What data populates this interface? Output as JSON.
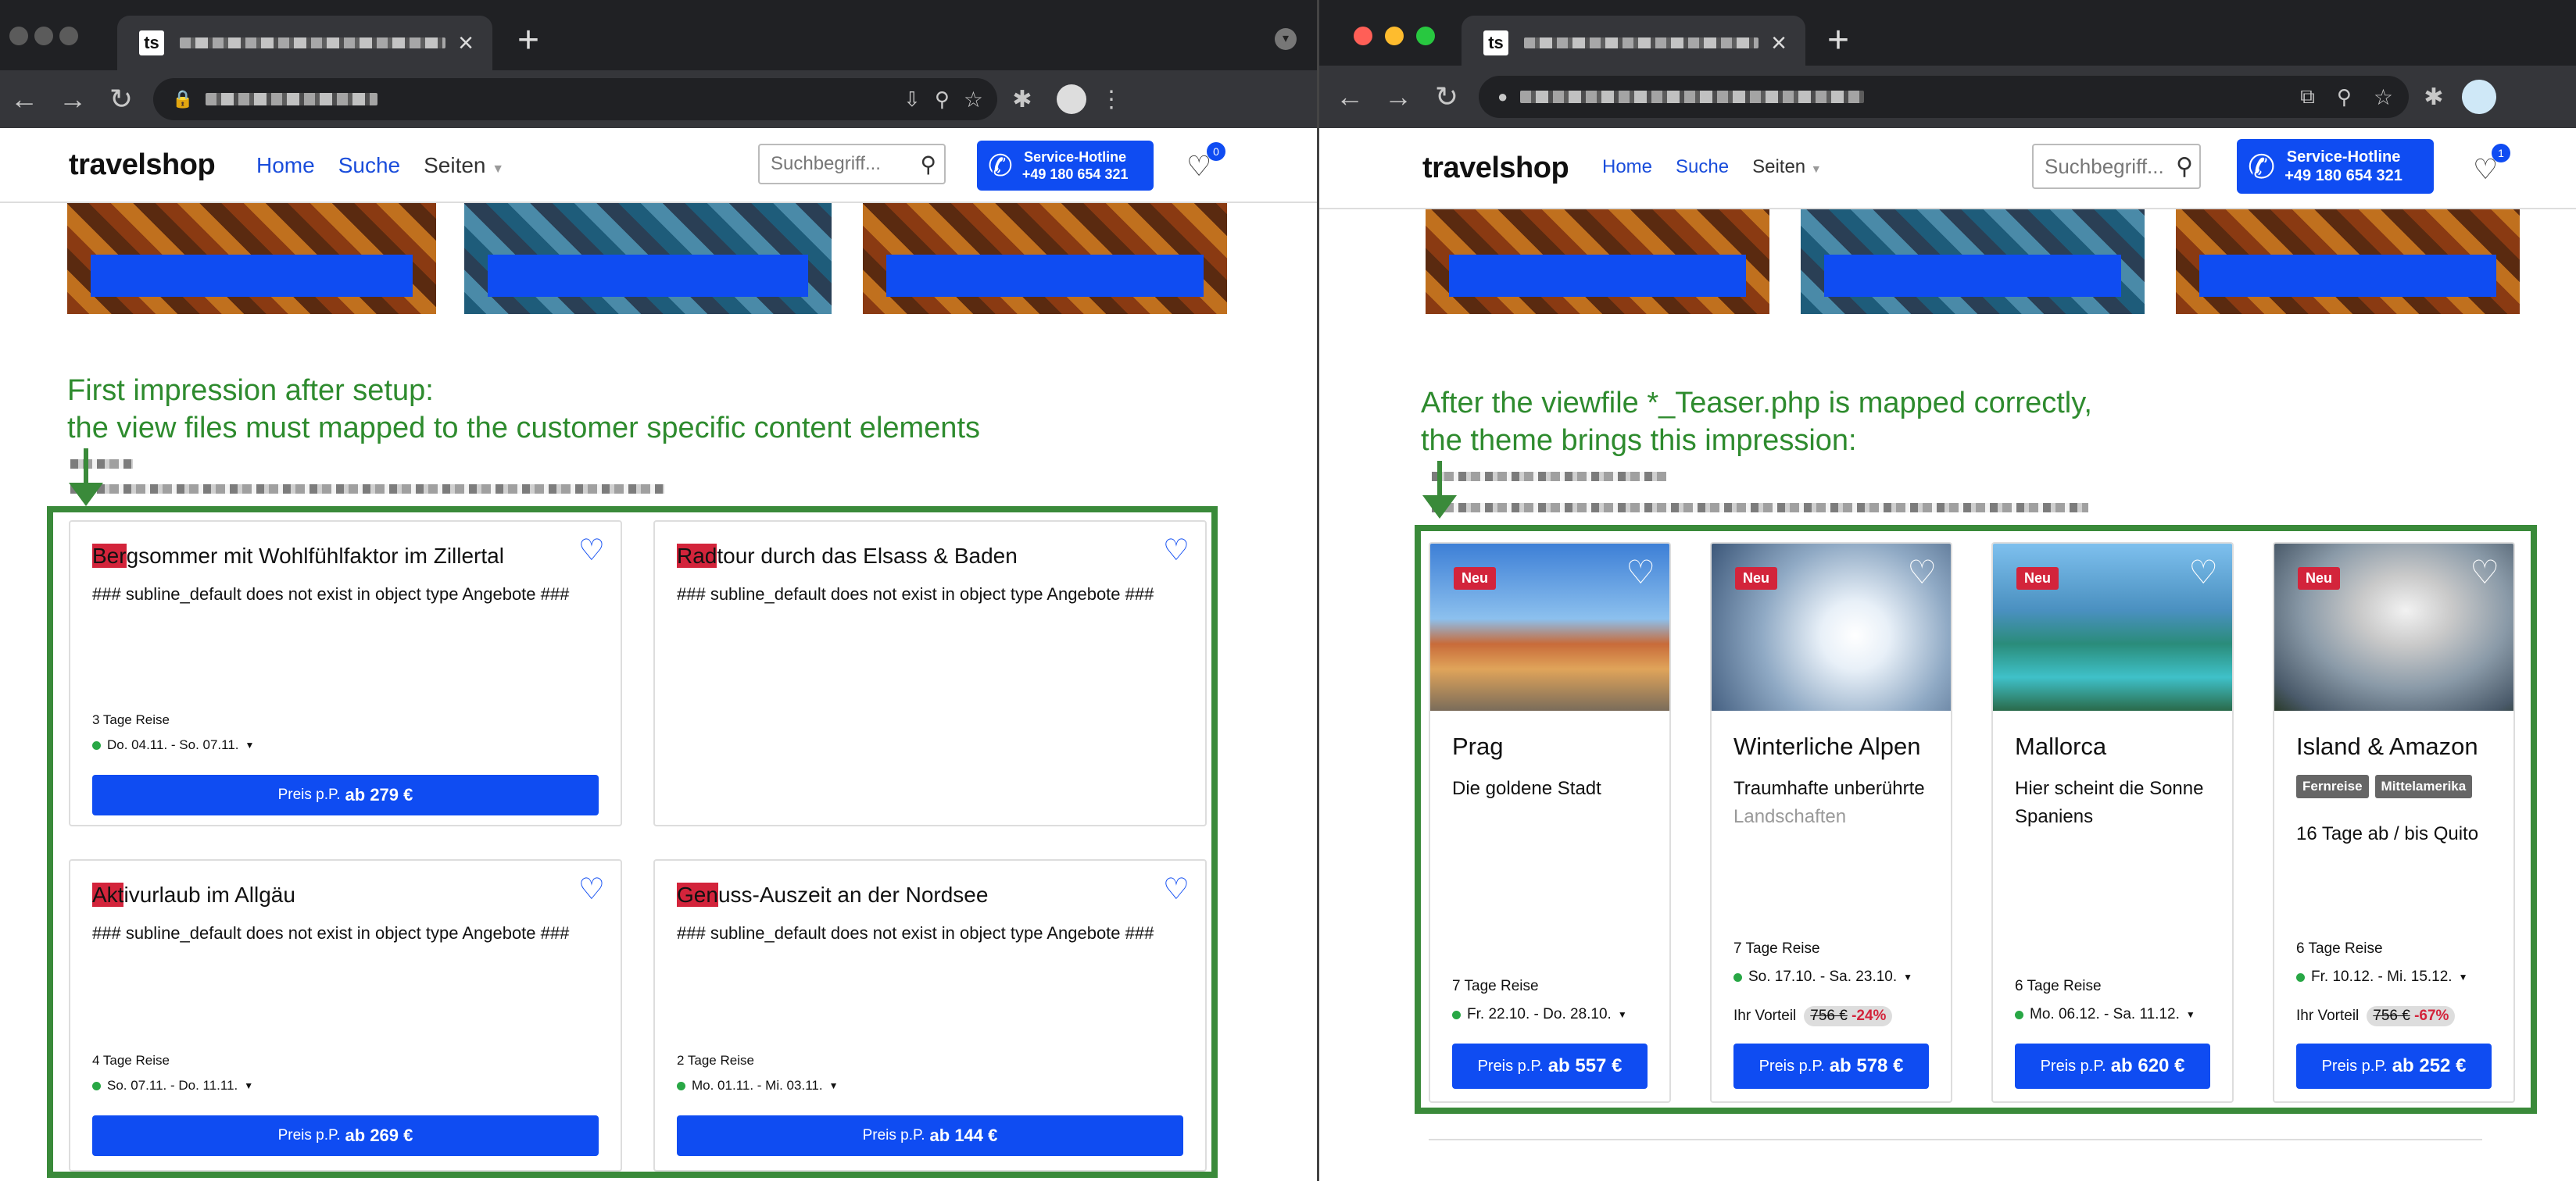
{
  "left": {
    "tab": {
      "favicon": "ts",
      "close": "×",
      "new": "+"
    },
    "site": {
      "logo": "travelshop",
      "nav": [
        "Home",
        "Suche",
        "Seiten"
      ],
      "search_placeholder": "Suchbegriff...",
      "hotline": [
        "Service-Hotline",
        "+49 180 654 321"
      ],
      "wishlist_count": "0"
    },
    "annotation": [
      "First impression after setup:",
      "the view files must mapped to the customer specific content elements"
    ],
    "cards": [
      {
        "tag": "Ber",
        "title": "gsommer mit Wohlfühlfaktor im Zillertal",
        "subline": "### subline_default does not exist in object type Angebote ###",
        "duration": "3 Tage Reise",
        "date": "Do. 04.11. - So. 07.11.",
        "price_prefix": "Preis p.P.",
        "price": "ab 279 €"
      },
      {
        "tag": "Rad",
        "title": "tour durch das Elsass & Baden",
        "subline": "### subline_default does not exist in object type Angebote ###"
      },
      {
        "tag": "Akt",
        "title": "ivurlaub im Allgäu",
        "subline": "### subline_default does not exist in object type Angebote ###",
        "duration": "4 Tage Reise",
        "date": "So. 07.11. - Do. 11.11.",
        "price_prefix": "Preis p.P.",
        "price": "ab 269 €"
      },
      {
        "tag": "Gen",
        "title": "uss-Auszeit an der Nordsee",
        "subline": "### subline_default does not exist in object type Angebote ###",
        "duration": "2 Tage Reise",
        "date": "Mo. 01.11. - Mi. 03.11.",
        "price_prefix": "Preis p.P.",
        "price": "ab 144 €"
      }
    ]
  },
  "right": {
    "tab": {
      "favicon": "ts",
      "close": "×",
      "new": "+"
    },
    "site": {
      "logo": "travelshop",
      "nav": [
        "Home",
        "Suche",
        "Seiten"
      ],
      "search_placeholder": "Suchbegriff...",
      "hotline": [
        "Service-Hotline",
        "+49 180 654 321"
      ],
      "wishlist_count": "1"
    },
    "annotation": [
      "After the viewfile *_Teaser.php is mapped correctly,",
      "the theme brings this impression:"
    ],
    "cards": [
      {
        "badge": "Neu",
        "title": "Prag",
        "subtitle": "Die goldene Stadt",
        "duration": "7 Tage Reise",
        "date": "Fr. 22.10. - Do. 28.10.",
        "price_prefix": "Preis p.P.",
        "price": "ab 557 €"
      },
      {
        "badge": "Neu",
        "title": "Winterliche Alpen",
        "subtitle": "Traumhafte unberührte",
        "subtitle_fade": "Landschaften",
        "duration": "7 Tage Reise",
        "date": "So. 17.10. - Sa. 23.10.",
        "benefit_label": "Ihr Vorteil",
        "old_price": "756 €",
        "discount": "-24%",
        "price_prefix": "Preis p.P.",
        "price": "ab 578 €"
      },
      {
        "badge": "Neu",
        "title": "Mallorca",
        "subtitle": "Hier scheint die Sonne Spaniens",
        "duration": "6 Tage Reise",
        "date": "Mo. 06.12. - Sa. 11.12.",
        "price_prefix": "Preis p.P.",
        "price": "ab 620 €"
      },
      {
        "badge": "Neu",
        "title": "Island & Amazon",
        "chips": [
          "Fernreise",
          "Mittelamerika"
        ],
        "subtitle2": "16 Tage ab / bis Quito",
        "duration": "6 Tage Reise",
        "date": "Fr. 10.12. - Mi. 15.12.",
        "benefit_label": "Ihr Vorteil",
        "old_price": "756 €",
        "discount": "-67%",
        "price_prefix": "Preis p.P.",
        "price": "ab 252 €"
      }
    ]
  },
  "colors": {
    "brand_blue": "#0f4cf2",
    "badge_red": "#d3243b",
    "annotation_green": "#2e8b2e"
  }
}
